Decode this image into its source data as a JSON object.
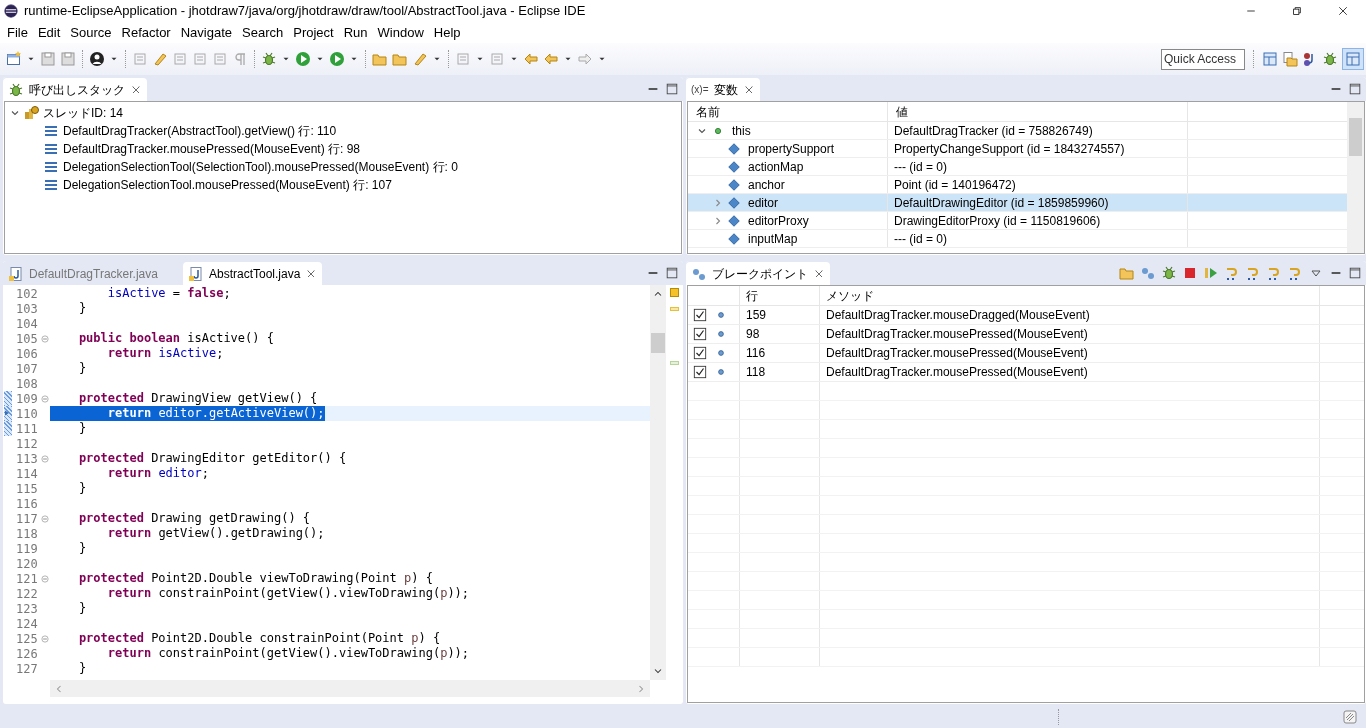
{
  "window": {
    "title": "runtime-EclipseApplication - jhotdraw7/java/org/jhotdraw/draw/tool/AbstractTool.java - Eclipse IDE"
  },
  "menu": [
    "File",
    "Edit",
    "Source",
    "Refactor",
    "Navigate",
    "Search",
    "Project",
    "Run",
    "Window",
    "Help"
  ],
  "quick_access": {
    "placeholder": "Quick Access"
  },
  "call_stack": {
    "tab": "呼び出しスタック",
    "thread": {
      "label": "スレッドID: 14",
      "expanded": true,
      "frames": [
        "DefaultDragTracker(AbstractTool).getView() 行: 110",
        "DefaultDragTracker.mousePressed(MouseEvent) 行: 98",
        "DelegationSelectionTool(SelectionTool).mousePressed(MouseEvent) 行: 0",
        "DelegationSelectionTool.mousePressed(MouseEvent) 行: 107"
      ]
    }
  },
  "variables": {
    "tab": "変数",
    "tab_prefix": "(x)=",
    "columns": [
      "名前",
      "値"
    ],
    "rows": [
      {
        "name": "this",
        "value": "DefaultDragTracker (id = 758826749)",
        "kind": "local",
        "expanded": true,
        "selected": false
      },
      {
        "name": "propertySupport",
        "value": "PropertyChangeSupport (id = 1843274557)",
        "kind": "field",
        "selected": false
      },
      {
        "name": "actionMap",
        "value": "--- (id = 0)",
        "kind": "field",
        "selected": false
      },
      {
        "name": "anchor",
        "value": "Point (id = 140196472)",
        "kind": "field",
        "selected": false
      },
      {
        "name": "editor",
        "value": "DefaultDrawingEditor (id = 1859859960)",
        "kind": "field",
        "expanded": false,
        "selected": true
      },
      {
        "name": "editorProxy",
        "value": "DrawingEditorProxy (id = 1150819606)",
        "kind": "field",
        "expanded": false,
        "selected": false
      },
      {
        "name": "inputMap",
        "value": "--- (id = 0)",
        "kind": "field",
        "selected": false
      }
    ]
  },
  "editor": {
    "tabs": [
      {
        "label": "DefaultDragTracker.java",
        "selected": false
      },
      {
        "label": "AbstractTool.java",
        "selected": true
      }
    ],
    "lines": [
      {
        "num": "102",
        "segs": [
          {
            "kind": "field",
            "text": "        isActive"
          },
          {
            "kind": "plain",
            "text": " = "
          },
          {
            "kind": "kw",
            "text": "false"
          },
          {
            "kind": "plain",
            "text": ";"
          }
        ]
      },
      {
        "num": "103",
        "segs": [
          {
            "kind": "plain",
            "text": "    }"
          }
        ]
      },
      {
        "num": "104"
      },
      {
        "num": "105",
        "fold": true,
        "segs": [
          {
            "kind": "kw",
            "text": "    public boolean"
          },
          {
            "kind": "plain",
            "text": " isActive() {"
          }
        ]
      },
      {
        "num": "106",
        "segs": [
          {
            "kind": "kw",
            "text": "        return"
          },
          {
            "kind": "field",
            "text": " isActive"
          },
          {
            "kind": "plain",
            "text": ";"
          }
        ]
      },
      {
        "num": "107",
        "segs": [
          {
            "kind": "plain",
            "text": "    }"
          }
        ]
      },
      {
        "num": "108"
      },
      {
        "num": "109",
        "fold": true,
        "range": true,
        "segs": [
          {
            "kind": "kw",
            "text": "    protected"
          },
          {
            "kind": "plain",
            "text": " DrawingView getView() {"
          }
        ]
      },
      {
        "num": "110",
        "range": true,
        "current": true,
        "segs": [
          {
            "kind": "kw",
            "text": "        return"
          },
          {
            "kind": "plain",
            "text": " editor.getActiveView();"
          }
        ]
      },
      {
        "num": "111",
        "range": true,
        "segs": [
          {
            "kind": "plain",
            "text": "    }"
          }
        ]
      },
      {
        "num": "112"
      },
      {
        "num": "113",
        "fold": true,
        "segs": [
          {
            "kind": "kw",
            "text": "    protected"
          },
          {
            "kind": "plain",
            "text": " DrawingEditor getEditor() {"
          }
        ]
      },
      {
        "num": "114",
        "segs": [
          {
            "kind": "kw",
            "text": "        return"
          },
          {
            "kind": "field",
            "text": " editor"
          },
          {
            "kind": "plain",
            "text": ";"
          }
        ]
      },
      {
        "num": "115",
        "segs": [
          {
            "kind": "plain",
            "text": "    }"
          }
        ]
      },
      {
        "num": "116"
      },
      {
        "num": "117",
        "fold": true,
        "segs": [
          {
            "kind": "kw",
            "text": "    protected"
          },
          {
            "kind": "plain",
            "text": " Drawing getDrawing() {"
          }
        ]
      },
      {
        "num": "118",
        "segs": [
          {
            "kind": "kw",
            "text": "        return"
          },
          {
            "kind": "plain",
            "text": " getView().getDrawing();"
          }
        ]
      },
      {
        "num": "119",
        "segs": [
          {
            "kind": "plain",
            "text": "    }"
          }
        ]
      },
      {
        "num": "120"
      },
      {
        "num": "121",
        "fold": true,
        "segs": [
          {
            "kind": "kw",
            "text": "    protected"
          },
          {
            "kind": "plain",
            "text": " Point2D.Double viewToDrawing(Point "
          },
          {
            "kind": "param",
            "text": "p"
          },
          {
            "kind": "plain",
            "text": ") {"
          }
        ]
      },
      {
        "num": "122",
        "segs": [
          {
            "kind": "kw",
            "text": "        return"
          },
          {
            "kind": "plain",
            "text": " constrainPoint(getView().viewToDrawing("
          },
          {
            "kind": "param",
            "text": "p"
          },
          {
            "kind": "plain",
            "text": "));"
          }
        ]
      },
      {
        "num": "123",
        "segs": [
          {
            "kind": "plain",
            "text": "    }"
          }
        ]
      },
      {
        "num": "124"
      },
      {
        "num": "125",
        "fold": true,
        "segs": [
          {
            "kind": "kw",
            "text": "    protected"
          },
          {
            "kind": "plain",
            "text": " Point2D.Double constrainPoint(Point "
          },
          {
            "kind": "param",
            "text": "p"
          },
          {
            "kind": "plain",
            "text": ") {"
          }
        ]
      },
      {
        "num": "126",
        "segs": [
          {
            "kind": "kw",
            "text": "        return"
          },
          {
            "kind": "plain",
            "text": " constrainPoint(getView().viewToDrawing("
          },
          {
            "kind": "param",
            "text": "p"
          },
          {
            "kind": "plain",
            "text": "));"
          }
        ]
      },
      {
        "num": "127",
        "segs": [
          {
            "kind": "plain",
            "text": "    }"
          }
        ]
      }
    ]
  },
  "breakpoints": {
    "tab": "ブレークポイント",
    "columns": [
      "行",
      "メソッド"
    ],
    "rows": [
      {
        "line": "159",
        "method": "DefaultDragTracker.mouseDragged(MouseEvent)",
        "checked": true
      },
      {
        "line": "98",
        "method": "DefaultDragTracker.mousePressed(MouseEvent)",
        "checked": true
      },
      {
        "line": "116",
        "method": "DefaultDragTracker.mousePressed(MouseEvent)",
        "checked": true
      },
      {
        "line": "118",
        "method": "DefaultDragTracker.mousePressed(MouseEvent)",
        "checked": true
      }
    ]
  }
}
